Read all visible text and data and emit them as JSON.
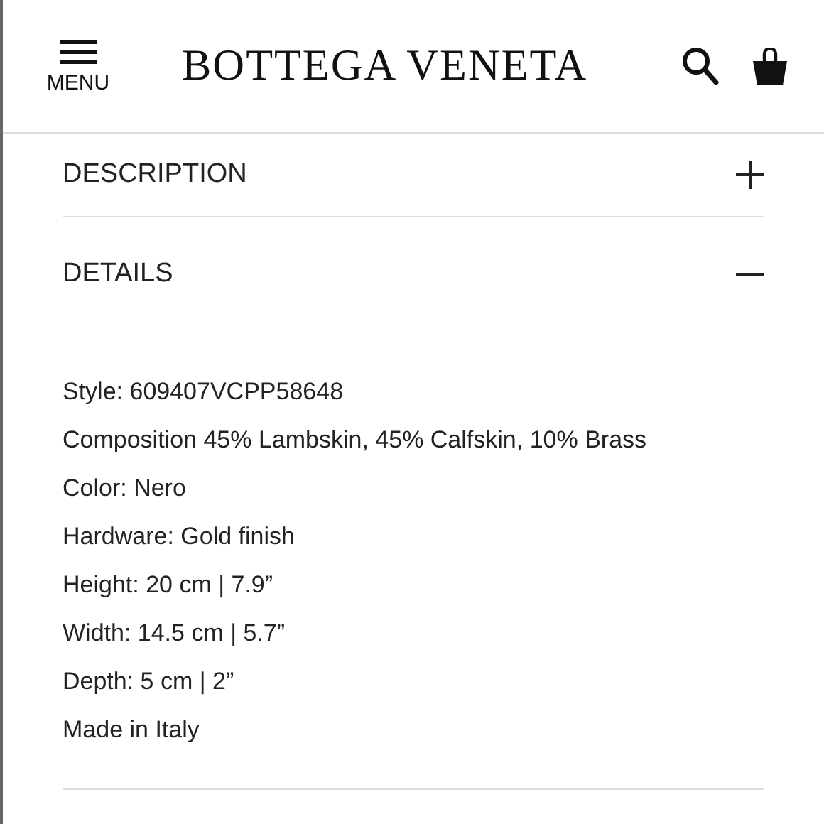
{
  "header": {
    "menu_label": "MENU",
    "logo": "BOTTEGA VENETA"
  },
  "sections": [
    {
      "title": "DESCRIPTION",
      "expanded": false
    },
    {
      "title": "DETAILS",
      "expanded": true,
      "lines": [
        "Style: 609407VCPP58648",
        "Composition 45% Lambskin, 45% Calfskin, 10% Brass",
        "Color: Nero",
        "Hardware: Gold finish",
        "Height: 20 cm | 7.9”",
        "Width: 14.5 cm | 5.7”",
        "Depth: 5 cm | 2”",
        "Made in Italy"
      ]
    }
  ]
}
